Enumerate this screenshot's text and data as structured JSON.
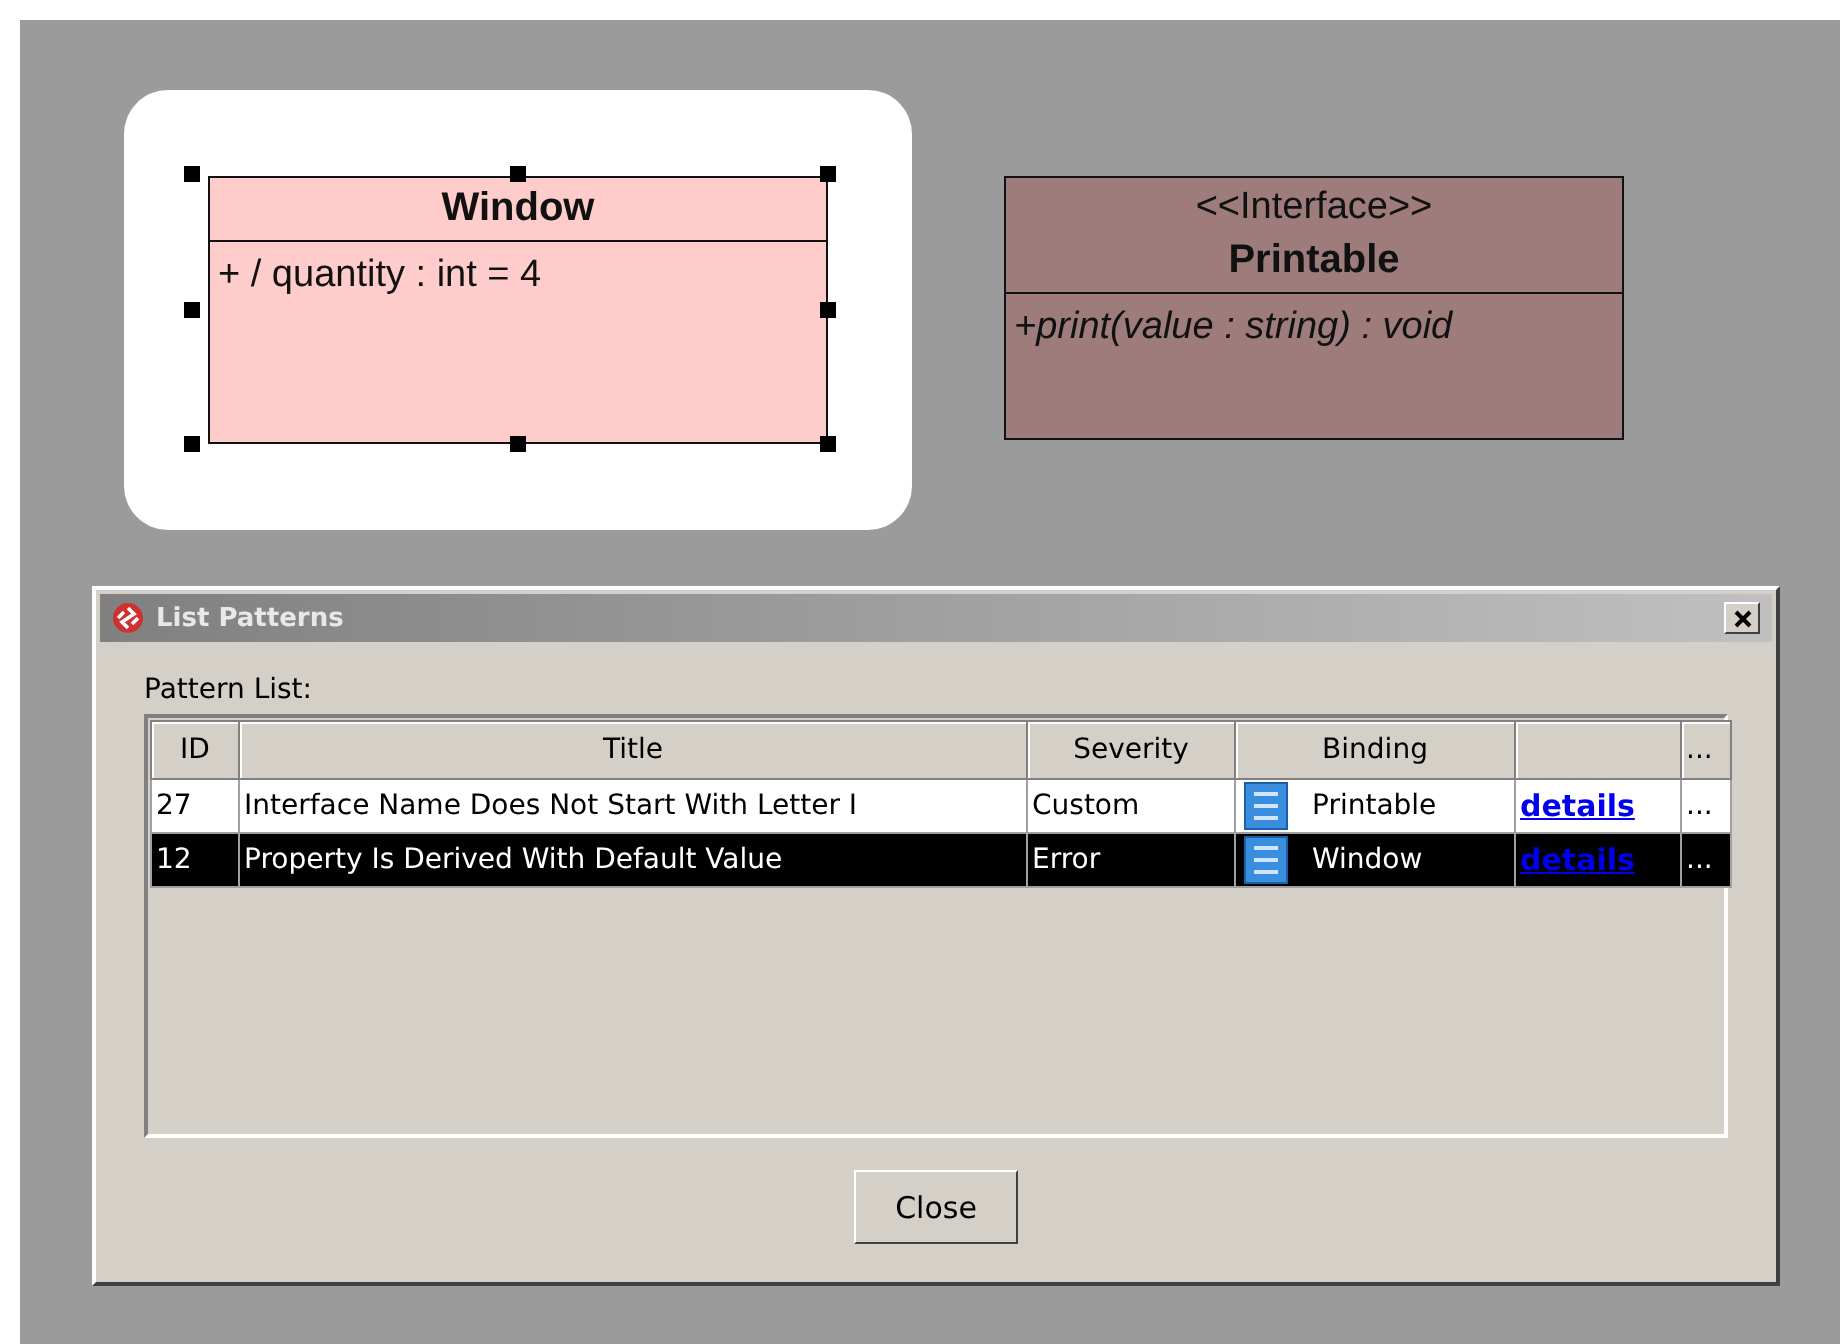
{
  "diagram": {
    "classes": [
      {
        "name": "Window",
        "selected": true,
        "color": "#ffcccc",
        "members": [
          {
            "kind": "attribute",
            "text": "+ / quantity : int = 4"
          }
        ]
      },
      {
        "name": "Printable",
        "stereotype": "<<Interface>>",
        "selected": false,
        "color": "#9e7c7c",
        "members": [
          {
            "kind": "operation",
            "text": "+print(value : string) : void"
          }
        ]
      }
    ]
  },
  "dialog": {
    "title": "List Patterns",
    "list_label": "Pattern List:",
    "columns": [
      "ID",
      "Title",
      "Severity",
      "Binding",
      "",
      "..."
    ],
    "rows": [
      {
        "id": "27",
        "title": "Interface Name Does Not Start With Letter I",
        "severity": "Custom",
        "binding": "Printable",
        "link": "details",
        "more": "...",
        "selected": false
      },
      {
        "id": "12",
        "title": "Property Is Derived With Default Value",
        "severity": "Error",
        "binding": "Window",
        "link": "details",
        "more": "...",
        "selected": true
      }
    ],
    "close_button": "Close"
  }
}
